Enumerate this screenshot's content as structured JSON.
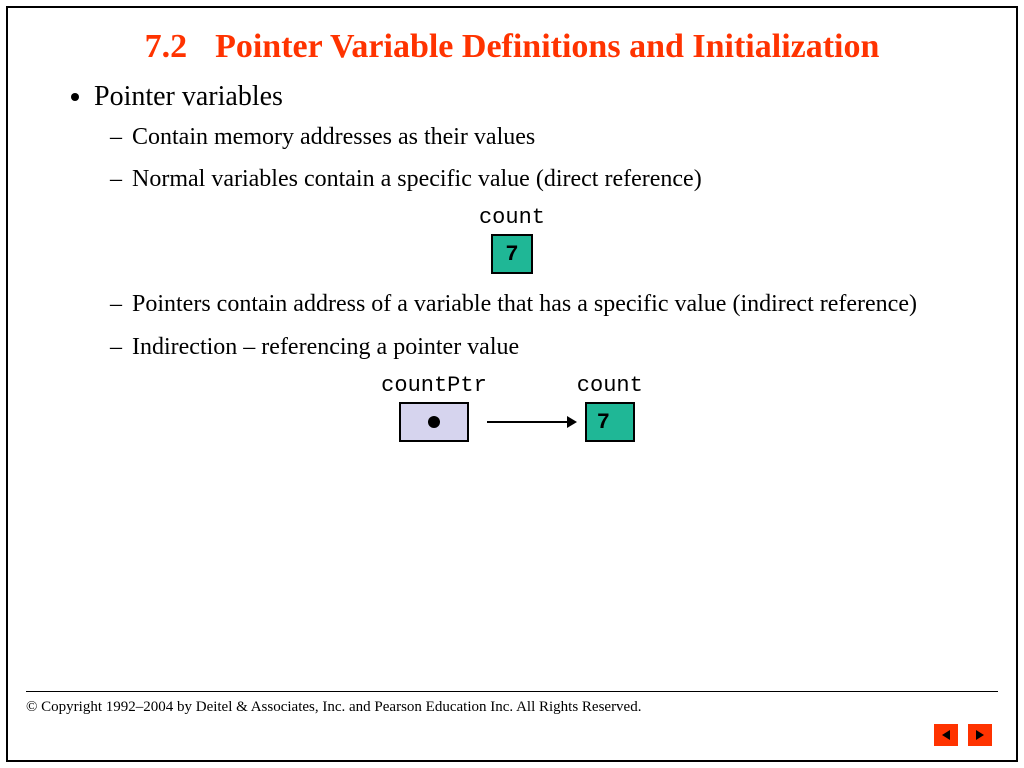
{
  "section_number": "7.2",
  "title": "Pointer Variable Definitions and Initialization",
  "bullet_main": "Pointer variables",
  "sub": {
    "a": "Contain memory addresses as their values",
    "b": "Normal variables contain a specific value (direct reference)",
    "c": "Pointers contain address of a variable that has a specific value (indirect reference)",
    "d": "Indirection – referencing a pointer value"
  },
  "diagram1": {
    "label": "count",
    "value": "7"
  },
  "diagram2": {
    "ptr_label": "countPtr",
    "var_label": "count",
    "var_value": "7"
  },
  "footer": "© Copyright 1992–2004 by Deitel & Associates, Inc. and Pearson Education Inc. All Rights Reserved.",
  "nav": {
    "prev": "previous",
    "next": "next"
  }
}
